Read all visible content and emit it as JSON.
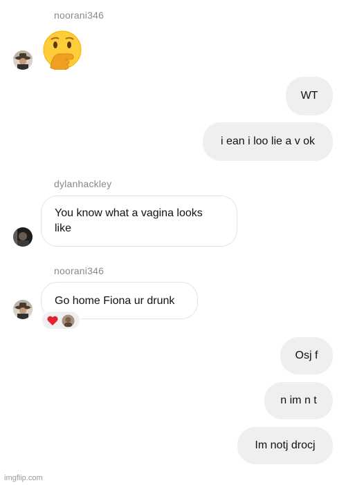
{
  "messages": {
    "sender1": "noorani346",
    "sender2": "dylanhackley",
    "sender3": "noorani346",
    "out_wt": "WT",
    "out_ean": "i ean i loo lie a v ok",
    "in_vagina_line1": "You know what a vagina looks",
    "in_vagina_line2": "like",
    "in_fiona": "Go home Fiona ur drunk",
    "out_osj": "Osj f",
    "out_nim": "n im n t",
    "out_lm": "Im notj drocj"
  },
  "icons": {
    "big_emoji": "face-with-hand-over-mouth-emoji",
    "reaction_1": "red-heart",
    "reaction_2": "reactor-avatar"
  },
  "watermark": "imgflip.com"
}
